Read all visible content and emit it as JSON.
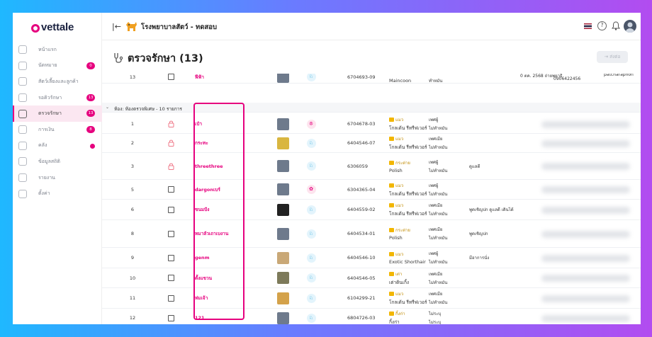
{
  "brand": {
    "name": "vettale",
    "accent": "#e6007e"
  },
  "header": {
    "hospital": "โรงพยาบาลสัตว์ - ทดสอบ",
    "collapse_icon": "collapse-left-icon"
  },
  "sidebar": {
    "items": [
      {
        "label": "หน้าแรก",
        "icon": "home-icon"
      },
      {
        "label": "นัดหมาย",
        "icon": "calendar-icon",
        "badge": "0"
      },
      {
        "label": "สัตว์เลี้ยงและลูกค้า",
        "icon": "paw-icon"
      },
      {
        "label": "รอคิวรักษา",
        "icon": "queue-icon",
        "badge": "13"
      },
      {
        "label": "ตรวจรักษา",
        "icon": "stethoscope-icon",
        "badge": "13",
        "active": true
      },
      {
        "label": "การเงิน",
        "icon": "money-icon",
        "badge": "8"
      },
      {
        "label": "คลัง",
        "icon": "inventory-icon",
        "dot": true
      },
      {
        "label": "ข้อมูลสถิติ",
        "icon": "stats-icon"
      },
      {
        "label": "รายงาน",
        "icon": "report-icon"
      },
      {
        "label": "ตั้งค่า",
        "icon": "settings-icon"
      }
    ]
  },
  "page": {
    "title": "ตรวจรักษา (13)",
    "export_label": "ส่งต่อ"
  },
  "partial_row": {
    "no": "13",
    "name": "ฟีฟ้า",
    "hn": "6704693-09",
    "breed": "Maincoon",
    "sex": "ทำหมัน",
    "note": "0 ตค. 2568 ถ่ายพยาธิ",
    "phone": "0906422456",
    "owner": "patcharaphon"
  },
  "group": {
    "label": "ห้อง: ห้องตรวจพิเศษ - 10 รายการ"
  },
  "rows": [
    {
      "no": "1",
      "locked": true,
      "name": "เป๋า",
      "photo": "placeholder",
      "type": "cat",
      "hn": "6704678-03",
      "breed_top": "แมว",
      "breed": "โกลเด้น รีทรีฟเวอร์",
      "sex1": "เพศผู้",
      "sex2": "ไม่ทำหมัน",
      "note": ""
    },
    {
      "no": "2",
      "locked": true,
      "name": "กระทะ",
      "photo": "yellow",
      "type": "dog",
      "hn": "6404546-07",
      "breed_top": "แมว",
      "breed": "โกลเด้น รีทรีฟเวอร์",
      "sex1": "เพศเมีย",
      "sex2": "ไม่ทำหมัน",
      "note": ""
    },
    {
      "no": "3",
      "locked": true,
      "name": "threethree",
      "photo": "placeholder",
      "type": "dog",
      "hn": "6306059",
      "breed_top": "กระต่าย",
      "breed": "Polish",
      "sex1": "เพศผู้",
      "sex2": "ไม่ทำหมัน",
      "note": "ดูแลดี"
    },
    {
      "no": "5",
      "locked": false,
      "name": "dargonเบร์",
      "photo": "placeholder",
      "type": "other",
      "hn": "6304365-04",
      "breed_top": "แมว",
      "breed": "โกลเด้น รีทรีฟเวอร์",
      "sex1": "เพศผู้",
      "sex2": "ไม่ทำหมัน",
      "note": ""
    },
    {
      "no": "6",
      "locked": false,
      "name": "ขนมปัง",
      "photo": "black",
      "type": "dog",
      "hn": "6404559-02",
      "breed_top": "แมว",
      "breed": "โกลเด้น รีทรีฟเวอร์",
      "sex1": "เพศเมีย",
      "sex2": "ไม่ทำหมัน",
      "note": "พูดเชิญปก ดูแลดี เดินได้"
    },
    {
      "no": "8",
      "locked": false,
      "name": "หมาลัวเถาเบงาน",
      "photo": "placeholder",
      "type": "dog",
      "hn": "6404534-01",
      "breed_top": "กระต่าย",
      "breed": "Polish",
      "sex1": "เพศเมีย",
      "sex2": "ไม่ทำหมัน",
      "note": "พูดเชิญปก"
    },
    {
      "no": "9",
      "locked": false,
      "name": "genm",
      "photo": "tan",
      "type": "dog",
      "hn": "6404546-10",
      "breed_top": "แมว",
      "breed": "Exotic Shorthair",
      "sex1": "เพศผู้",
      "sex2": "ไม่ทำหมัน",
      "note": "มีอาการนั่ง"
    },
    {
      "no": "10",
      "locked": false,
      "name": "ตั้งแขวน",
      "photo": "turtle",
      "type": "dog",
      "hn": "6404546-05",
      "breed_top": "เต่า",
      "breed": "เต่าดินเกิ้ง",
      "sex1": "เพศเมีย",
      "sex2": "ไม่ทำหมัน",
      "note": ""
    },
    {
      "no": "11",
      "locked": false,
      "name": "ห่มเจ้า",
      "photo": "golden",
      "type": "dog",
      "hn": "6104299-21",
      "breed_top": "แมว",
      "breed": "โกลเด้น รีทรีฟเวอร์",
      "sex1": "เพศเมีย",
      "sex2": "ไม่ทำหมัน",
      "note": ""
    },
    {
      "no": "12",
      "locked": false,
      "name": "121",
      "photo": "placeholder",
      "type": "dog",
      "hn": "6804726-03",
      "breed_top": "กิ้งก่า",
      "breed": "กิ้งก่า",
      "sex1": "ไม่ระบุ",
      "sex2": "ไม่ระบุ",
      "note": ""
    }
  ]
}
